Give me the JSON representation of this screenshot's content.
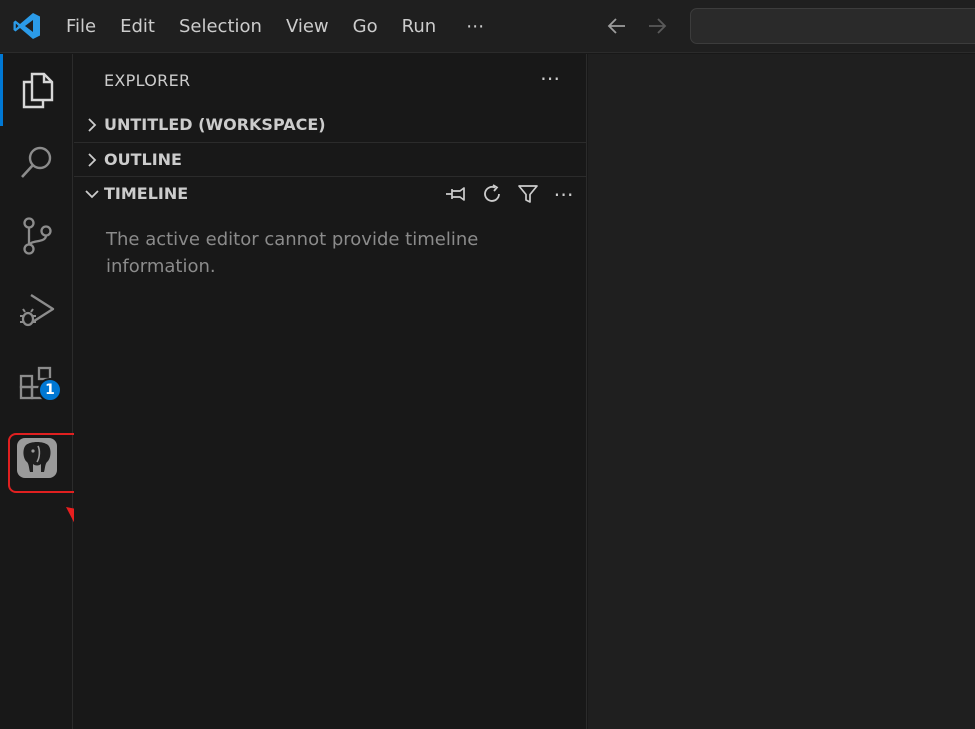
{
  "app": {
    "logo_icon": "vscode-logo-icon",
    "accent_color": "#0078d4"
  },
  "menu": {
    "items": [
      "File",
      "Edit",
      "Selection",
      "View",
      "Go",
      "Run"
    ],
    "more_label": "⋯"
  },
  "navigation": {
    "back_icon": "arrow-left-icon",
    "forward_icon": "arrow-right-icon"
  },
  "activity_bar": {
    "items": [
      {
        "icon": "files-icon",
        "active": true
      },
      {
        "icon": "search-icon",
        "active": false
      },
      {
        "icon": "source-control-icon",
        "active": false
      },
      {
        "icon": "run-debug-icon",
        "active": false
      },
      {
        "icon": "extensions-icon",
        "active": false,
        "badge": "1"
      },
      {
        "icon": "postgresql-elephant-icon",
        "active": false,
        "highlighted": true
      }
    ],
    "highlight_color": "#e02020"
  },
  "sidebar": {
    "title": "EXPLORER",
    "more_label": "⋯",
    "sections": [
      {
        "label": "UNTITLED (WORKSPACE)",
        "expanded": false
      },
      {
        "label": "OUTLINE",
        "expanded": false
      },
      {
        "label": "TIMELINE",
        "expanded": true
      }
    ],
    "timeline_actions": [
      "pin-icon",
      "refresh-icon",
      "filter-icon",
      "more-icon"
    ],
    "timeline_more_label": "⋯",
    "timeline_message": "The active editor cannot provide timeline information."
  }
}
